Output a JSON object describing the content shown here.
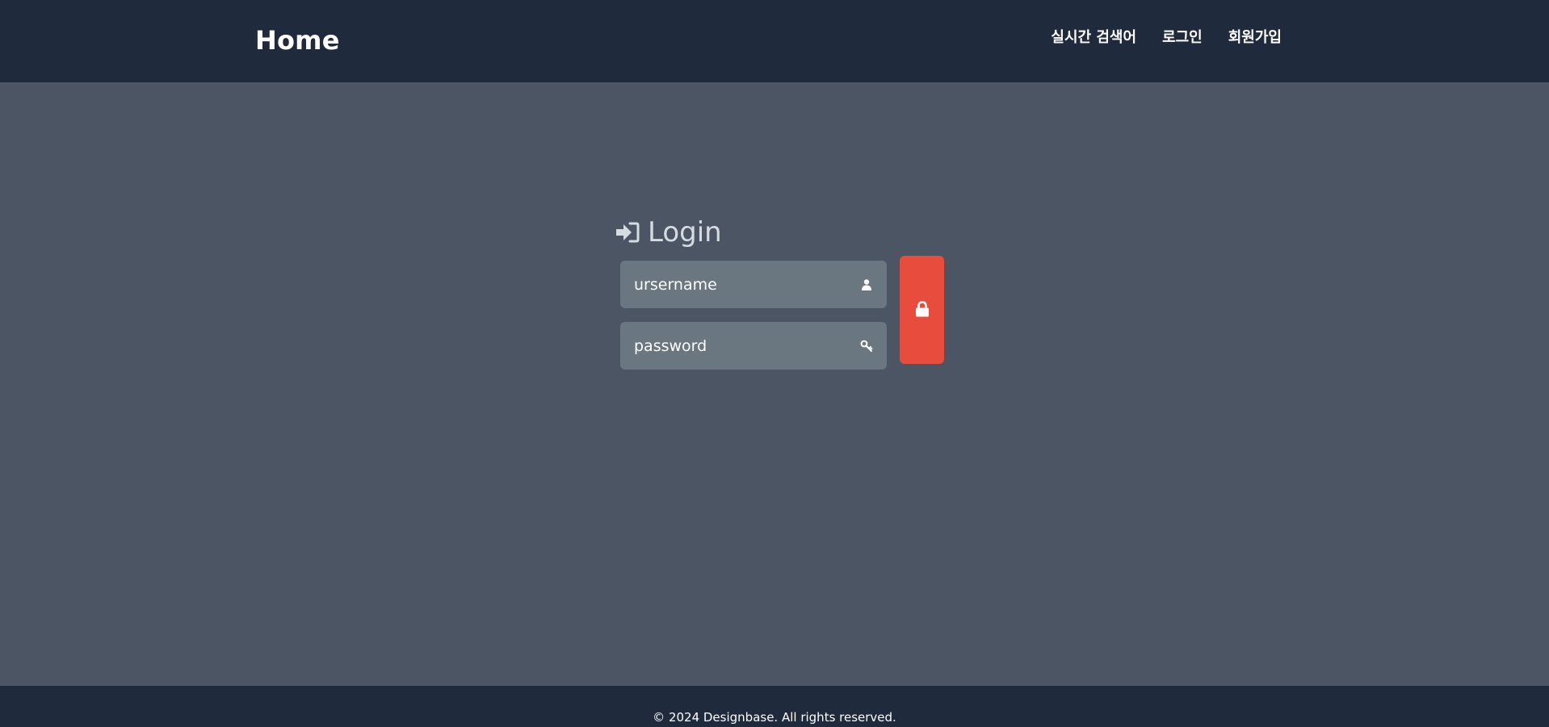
{
  "header": {
    "brand": "Home",
    "nav": [
      {
        "label": "실시간 검색어"
      },
      {
        "label": "로그인"
      },
      {
        "label": "회원가입"
      }
    ]
  },
  "login": {
    "title": "Login",
    "title_icon": "sign-in-icon",
    "username": {
      "placeholder": "ursername",
      "icon": "user-icon"
    },
    "password": {
      "placeholder": "password",
      "icon": "key-icon"
    },
    "submit_icon": "lock-icon"
  },
  "footer": {
    "copyright": "© 2024 Designbase. All rights reserved."
  },
  "colors": {
    "header_bg": "#1f2a3c",
    "page_bg": "#4b5563",
    "field_bg": "#6b7780",
    "accent": "#e74c3c"
  }
}
